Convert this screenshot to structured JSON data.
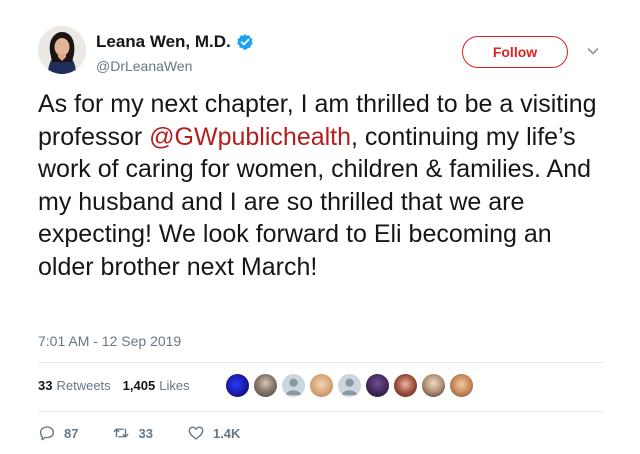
{
  "author": {
    "display_name": "Leana Wen, M.D.",
    "handle": "@DrLeanaWen",
    "verified": true
  },
  "follow_button": {
    "label": "Follow"
  },
  "tweet": {
    "text_before_mention": "As for my next chapter, I am thrilled to be a visiting professor ",
    "mention": "@GWpublichealth",
    "text_after_mention": ", continuing my life’s work of caring for women, children & families. And my husband and I are so thrilled that we are expecting! We look forward to Eli becoming an older brother next March!",
    "timestamp": "7:01 AM - 12 Sep 2019"
  },
  "stats": {
    "retweets_count": "33",
    "retweets_label": "Retweets",
    "likes_count": "1,405",
    "likes_label": "Likes"
  },
  "actions": {
    "replies": "87",
    "retweets": "33",
    "likes": "1.4K"
  },
  "colors": {
    "mention": "#b41e1e",
    "follow_border": "#dd2222",
    "verified": "#1da1f2",
    "secondary_text": "#657786"
  }
}
